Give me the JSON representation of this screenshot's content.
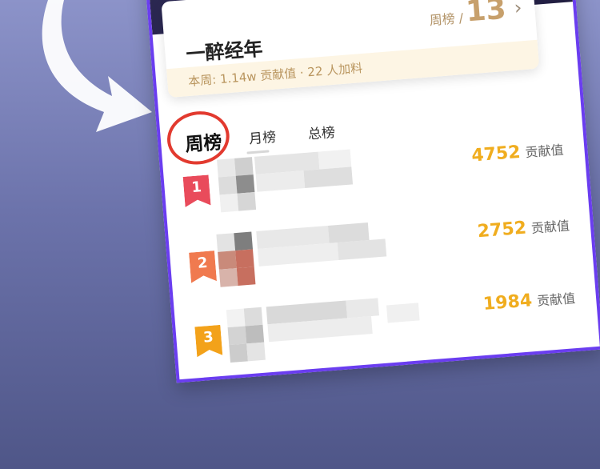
{
  "card": {
    "title": "一醉经年",
    "rank_label": "周榜 /",
    "rank_number": "13",
    "stats": "本周: 1.14w 贡献值 · 22 人加料"
  },
  "tabs": [
    {
      "label": "周榜",
      "active": true
    },
    {
      "label": "月榜",
      "active": false
    },
    {
      "label": "总榜",
      "active": false
    }
  ],
  "leaderboard": [
    {
      "rank": "1",
      "value": "4752",
      "unit": "贡献值",
      "badge_color": "#e94b5b"
    },
    {
      "rank": "2",
      "value": "2752",
      "unit": "贡献值",
      "badge_color": "#f07a4f"
    },
    {
      "rank": "3",
      "value": "1984",
      "unit": "贡献值",
      "badge_color": "#f3a21a"
    }
  ],
  "colors": {
    "score": "#f0ad1f",
    "frame": "#6a3df0",
    "highlight_circle": "#e23a2f"
  }
}
